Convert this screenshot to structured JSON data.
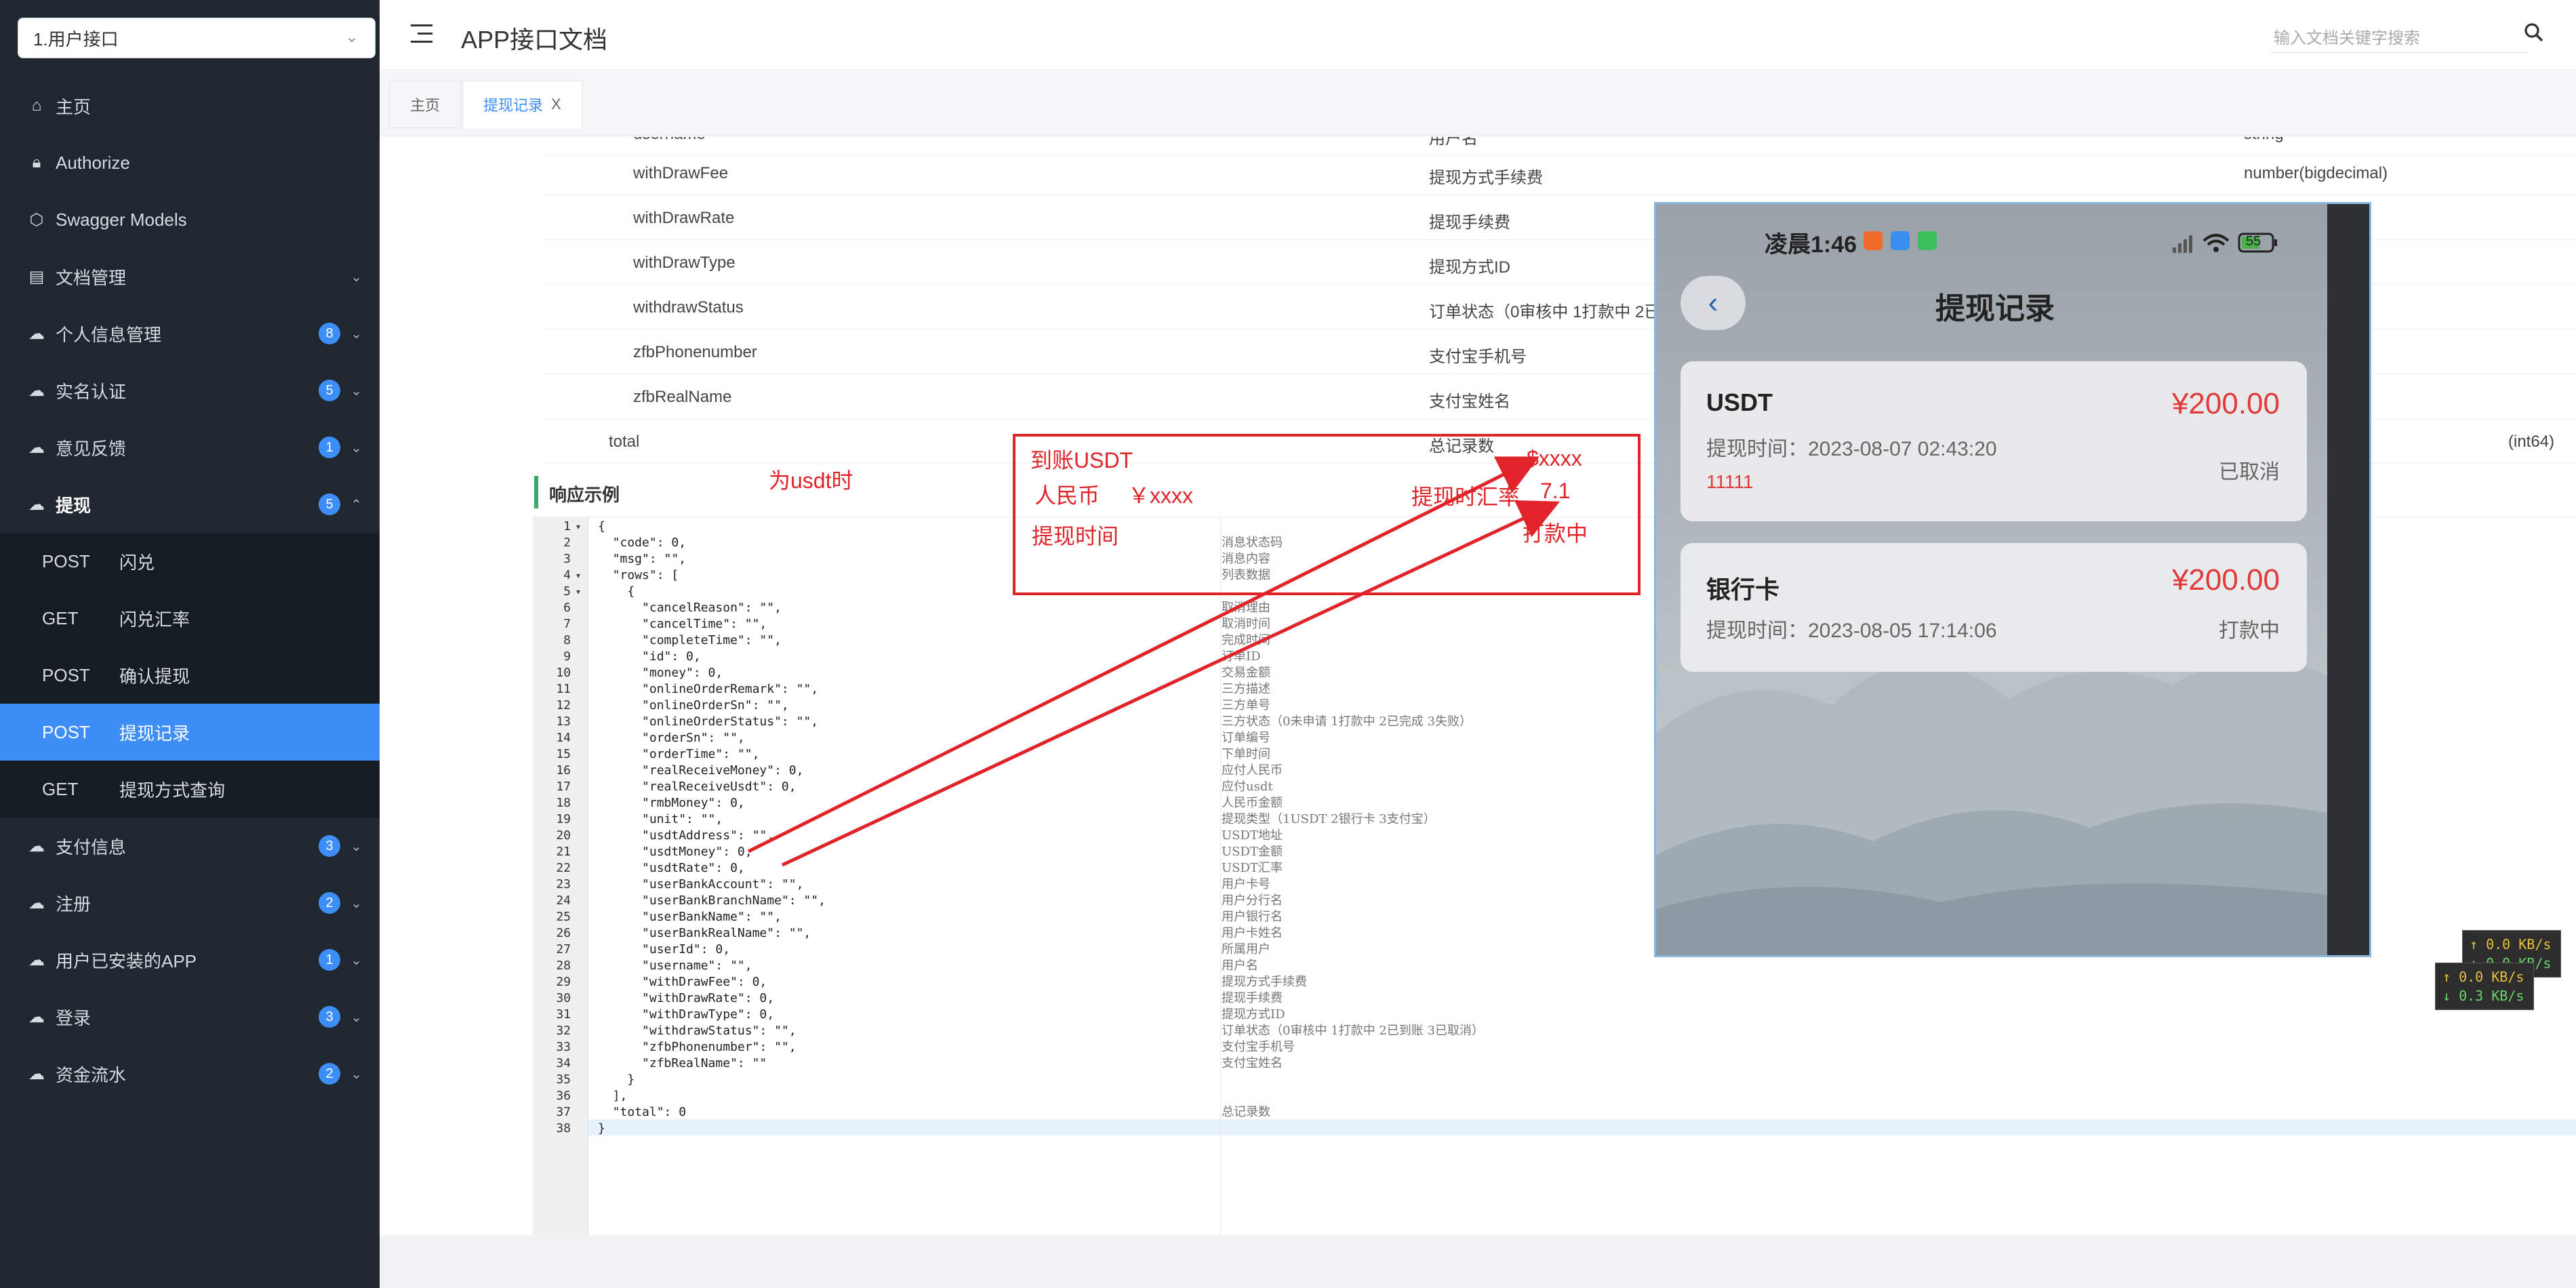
{
  "sidebar": {
    "group_select": "1.用户接口",
    "menu": [
      {
        "label": "主页",
        "icon": "home-icon"
      },
      {
        "label": "Authorize",
        "icon": "lock-icon"
      },
      {
        "label": "Swagger Models",
        "icon": "cube-icon"
      },
      {
        "label": "文档管理",
        "icon": "doc-icon"
      },
      {
        "label": "个人信息管理",
        "icon": "cloud-icon",
        "badge": "8"
      },
      {
        "label": "实名认证",
        "icon": "cloud-icon",
        "badge": "5"
      },
      {
        "label": "意见反馈",
        "icon": "cloud-icon",
        "badge": "1"
      },
      {
        "label": "提现",
        "icon": "cloud-icon",
        "badge": "5"
      }
    ],
    "sub_items": [
      {
        "method": "POST",
        "label": "闪兑"
      },
      {
        "method": "GET",
        "label": "闪兑汇率"
      },
      {
        "method": "POST",
        "label": "确认提现"
      },
      {
        "method": "POST",
        "label": "提现记录"
      },
      {
        "method": "GET",
        "label": "提现方式查询"
      }
    ],
    "menu_after": [
      {
        "label": "支付信息",
        "badge": "3"
      },
      {
        "label": "注册",
        "badge": "2"
      },
      {
        "label": "用户已安装的APP",
        "badge": "1"
      },
      {
        "label": "登录",
        "badge": "3"
      },
      {
        "label": "资金流水",
        "badge": "2"
      }
    ]
  },
  "header": {
    "title": "APP接口文档",
    "search_placeholder": "输入文档关键字搜索"
  },
  "tabs": [
    {
      "label": "主页"
    },
    {
      "label": "提现记录",
      "close": "X"
    }
  ],
  "params": [
    {
      "name": "username",
      "desc": "用户名",
      "type": "string"
    },
    {
      "name": "withDrawFee",
      "desc": "提现方式手续费",
      "type": "number(bigdecimal)"
    },
    {
      "name": "withDrawRate",
      "desc": "提现手续费",
      "type": ""
    },
    {
      "name": "withDrawType",
      "desc": "提现方式ID",
      "type": ""
    },
    {
      "name": "withdrawStatus",
      "desc": "订单状态（0审核中 1打款中 2已到账 3已取消）",
      "type": ""
    },
    {
      "name": "zfbPhonenumber",
      "desc": "支付宝手机号",
      "type": ""
    },
    {
      "name": "zfbRealName",
      "desc": "支付宝姓名",
      "type": ""
    },
    {
      "name": "total",
      "desc": "总记录数",
      "type": "(int64)"
    }
  ],
  "response_title": "响应示例",
  "code_lines": [
    {
      "n": "1",
      "t": "{",
      "c": ""
    },
    {
      "n": "2",
      "t": "  \"code\": 0,",
      "c": "消息状态码"
    },
    {
      "n": "3",
      "t": "  \"msg\": \"\",",
      "c": "消息内容"
    },
    {
      "n": "4",
      "t": "  \"rows\": [",
      "c": "列表数据"
    },
    {
      "n": "5",
      "t": "    {",
      "c": ""
    },
    {
      "n": "6",
      "t": "      \"cancelReason\": \"\",",
      "c": "取消理由"
    },
    {
      "n": "7",
      "t": "      \"cancelTime\": \"\",",
      "c": "取消时间"
    },
    {
      "n": "8",
      "t": "      \"completeTime\": \"\",",
      "c": "完成时间"
    },
    {
      "n": "9",
      "t": "      \"id\": 0,",
      "c": "订单ID"
    },
    {
      "n": "10",
      "t": "      \"money\": 0,",
      "c": "交易金额"
    },
    {
      "n": "11",
      "t": "      \"onlineOrderRemark\": \"\",",
      "c": "三方描述"
    },
    {
      "n": "12",
      "t": "      \"onlineOrderSn\": \"\",",
      "c": "三方单号"
    },
    {
      "n": "13",
      "t": "      \"onlineOrderStatus\": \"\",",
      "c": "三方状态（0未申请 1打款中 2已完成 3失败）"
    },
    {
      "n": "14",
      "t": "      \"orderSn\": \"\",",
      "c": "订单编号"
    },
    {
      "n": "15",
      "t": "      \"orderTime\": \"\",",
      "c": "下单时间"
    },
    {
      "n": "16",
      "t": "      \"realReceiveMoney\": 0,",
      "c": "应付人民币"
    },
    {
      "n": "17",
      "t": "      \"realReceiveUsdt\": 0,",
      "c": "应付usdt"
    },
    {
      "n": "18",
      "t": "      \"rmbMoney\": 0,",
      "c": "人民币金额"
    },
    {
      "n": "19",
      "t": "      \"unit\": \"\",",
      "c": "提现类型（1USDT 2银行卡 3支付宝）"
    },
    {
      "n": "20",
      "t": "      \"usdtAddress\": \"\",",
      "c": "USDT地址"
    },
    {
      "n": "21",
      "t": "      \"usdtMoney\": 0,",
      "c": "USDT金额"
    },
    {
      "n": "22",
      "t": "      \"usdtRate\": 0,",
      "c": "USDT汇率"
    },
    {
      "n": "23",
      "t": "      \"userBankAccount\": \"\",",
      "c": "用户卡号"
    },
    {
      "n": "24",
      "t": "      \"userBankBranchName\": \"\",",
      "c": "用户分行名"
    },
    {
      "n": "25",
      "t": "      \"userBankName\": \"\",",
      "c": "用户银行名"
    },
    {
      "n": "26",
      "t": "      \"userBankRealName\": \"\",",
      "c": "用户卡姓名"
    },
    {
      "n": "27",
      "t": "      \"userId\": 0,",
      "c": "所属用户"
    },
    {
      "n": "28",
      "t": "      \"username\": \"\",",
      "c": "用户名"
    },
    {
      "n": "29",
      "t": "      \"withDrawFee\": 0,",
      "c": "提现方式手续费"
    },
    {
      "n": "30",
      "t": "      \"withDrawRate\": 0,",
      "c": "提现手续费"
    },
    {
      "n": "31",
      "t": "      \"withDrawType\": 0,",
      "c": "提现方式ID"
    },
    {
      "n": "32",
      "t": "      \"withdrawStatus\": \"\",",
      "c": "订单状态（0审核中 1打款中 2已到账 3已取消）"
    },
    {
      "n": "33",
      "t": "      \"zfbPhonenumber\": \"\",",
      "c": "支付宝手机号"
    },
    {
      "n": "34",
      "t": "      \"zfbRealName\": \"\"",
      "c": "支付宝姓名"
    },
    {
      "n": "35",
      "t": "    }",
      "c": ""
    },
    {
      "n": "36",
      "t": "  ],",
      "c": ""
    },
    {
      "n": "37",
      "t": "  \"total\": 0",
      "c": "总记录数"
    },
    {
      "n": "38",
      "t": "}",
      "c": ""
    }
  ],
  "annotations": {
    "usdt_note": "为usdt时",
    "arrive_usdt": "到账USDT",
    "rmb": "人民币",
    "rmb_val": "￥xxxx",
    "withdraw_time": "提现时间",
    "usd_val": "$xxxx",
    "rate_label": "提现时汇率",
    "rate_val": "7.1",
    "paying": "打款中"
  },
  "phone": {
    "time": "凌晨1:46",
    "battery": "55",
    "title": "提现记录",
    "cards": [
      {
        "title": "USDT",
        "amount": "¥200.00",
        "time": "提现时间：2023-08-07 02:43:20",
        "status": "已取消",
        "ref": "11111"
      },
      {
        "title": "银行卡",
        "amount": "¥200.00",
        "time": "提现时间：2023-08-05 17:14:06",
        "status": "打款中"
      }
    ]
  },
  "net": {
    "box1_up": "↑ 0.0 KB/s",
    "box1_dn": "↓ 0.0 KB/s",
    "box2_up": "↑ 0.0 KB/s",
    "box2_dn": "↓ 0.3 KB/s"
  }
}
